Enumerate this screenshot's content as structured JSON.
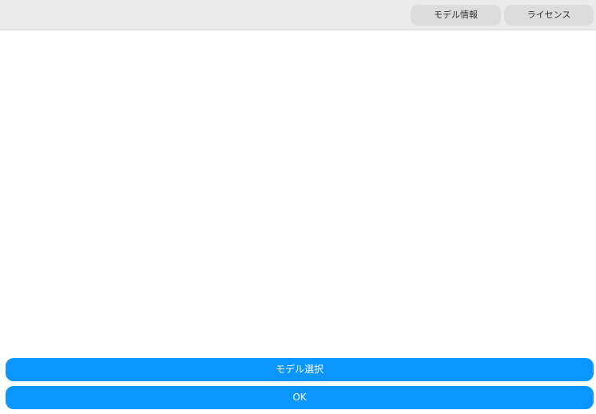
{
  "header": {
    "tabs": [
      {
        "label": "モデル情報"
      },
      {
        "label": "ライセンス"
      }
    ]
  },
  "footer": {
    "select_model_label": "モデル選択",
    "ok_label": "OK"
  },
  "colors": {
    "accent": "#0a95ff",
    "topbar_bg": "#ebebeb",
    "tab_bg": "#dcdcdc"
  }
}
